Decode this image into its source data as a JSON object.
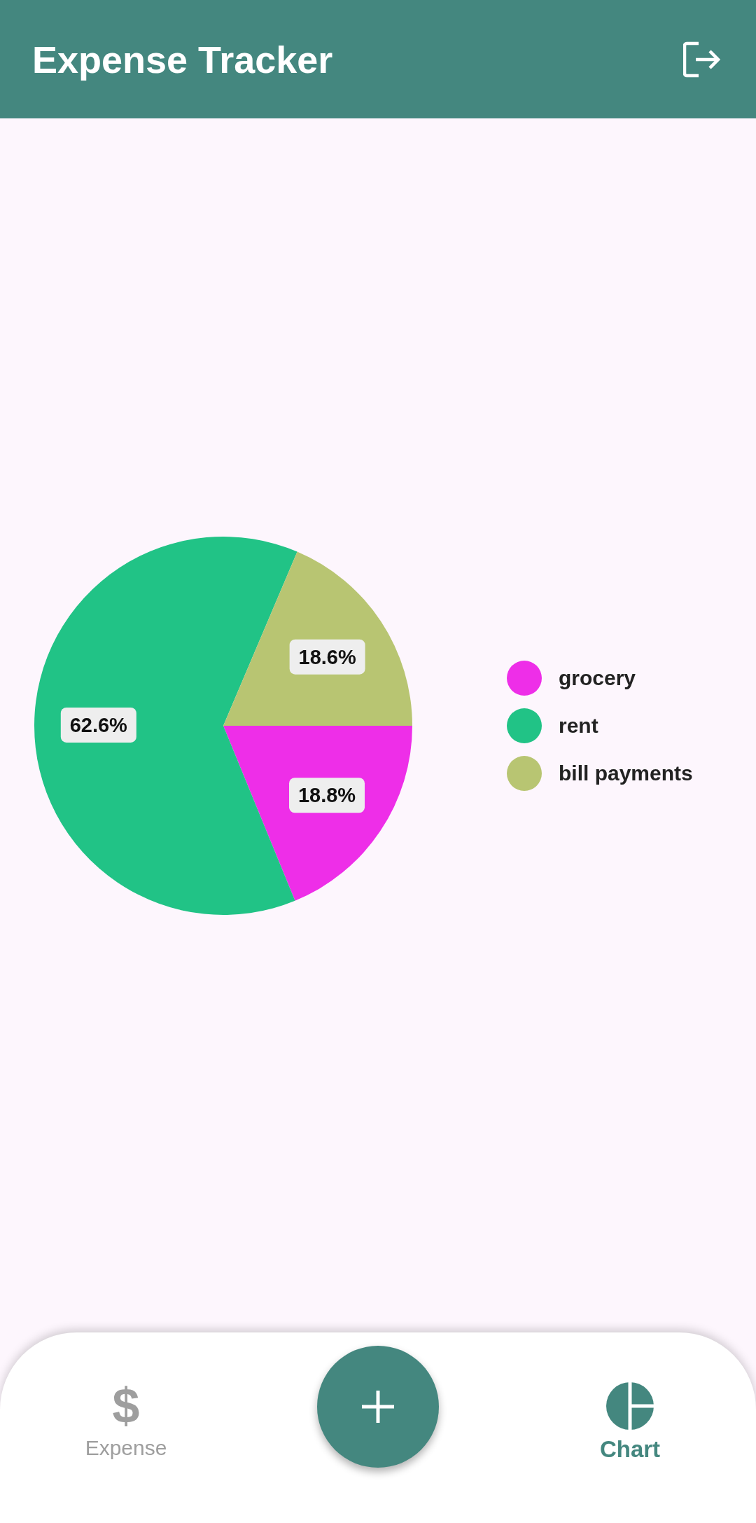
{
  "app_bar": {
    "title": "Expense Tracker"
  },
  "chart": {
    "chart_data": {
      "type": "pie",
      "categories": [
        "grocery",
        "rent",
        "bill payments"
      ],
      "values": [
        18.8,
        62.6,
        18.6
      ],
      "colors": [
        "#ee2ee8",
        "#21c386",
        "#b8c572"
      ],
      "value_labels": [
        "18.8%",
        "62.6%",
        "18.6%"
      ],
      "legend": "right"
    }
  },
  "bottom_nav": {
    "items": [
      {
        "label": "Expense",
        "icon_text": "$",
        "selected": false
      },
      {
        "label": "Chart",
        "selected": true
      }
    ]
  }
}
